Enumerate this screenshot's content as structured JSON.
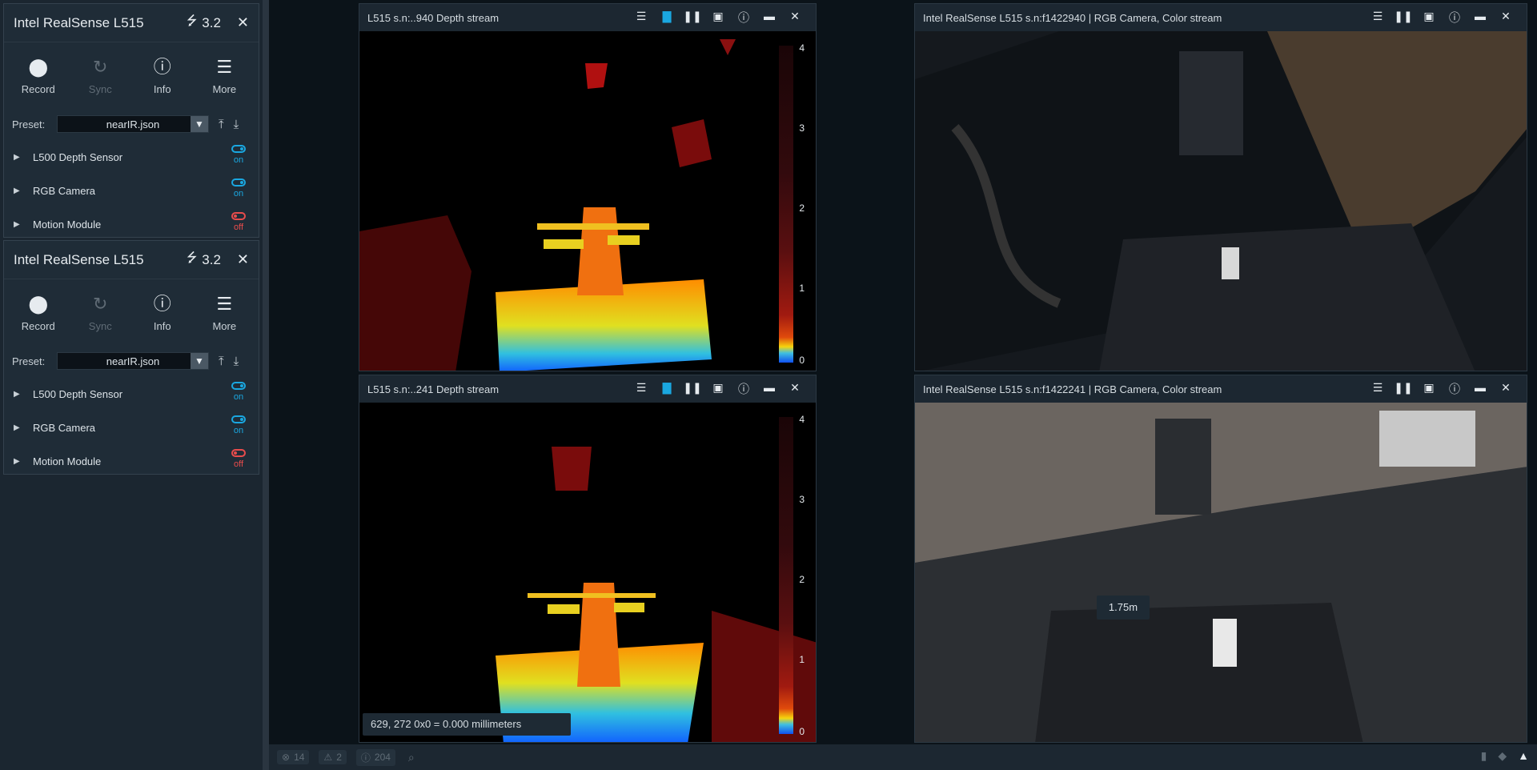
{
  "devices": [
    {
      "name": "Intel RealSense L515",
      "usb_version": "3.2",
      "tools": [
        {
          "label": "Record",
          "icon": "record-icon",
          "disabled": false
        },
        {
          "label": "Sync",
          "icon": "sync-icon",
          "disabled": true
        },
        {
          "label": "Info",
          "icon": "info-icon",
          "disabled": false
        },
        {
          "label": "More",
          "icon": "menu-icon",
          "disabled": false
        }
      ],
      "preset_label": "Preset:",
      "preset_value": "nearIR.json",
      "sensors": [
        {
          "name": "L500 Depth Sensor",
          "state": "on"
        },
        {
          "name": "RGB Camera",
          "state": "on"
        },
        {
          "name": "Motion Module",
          "state": "off"
        }
      ]
    },
    {
      "name": "Intel RealSense L515",
      "usb_version": "3.2",
      "tools": [
        {
          "label": "Record",
          "icon": "record-icon",
          "disabled": false
        },
        {
          "label": "Sync",
          "icon": "sync-icon",
          "disabled": true
        },
        {
          "label": "Info",
          "icon": "info-icon",
          "disabled": false
        },
        {
          "label": "More",
          "icon": "menu-icon",
          "disabled": false
        }
      ],
      "preset_label": "Preset:",
      "preset_value": "nearIR.json",
      "sensors": [
        {
          "name": "L500 Depth Sensor",
          "state": "on"
        },
        {
          "name": "RGB Camera",
          "state": "on"
        },
        {
          "name": "Motion Module",
          "state": "off"
        }
      ]
    }
  ],
  "streams": {
    "depth1": {
      "title": "L515 s.n:..940 Depth stream",
      "colorbar_ticks": [
        "4",
        "3",
        "2",
        "1",
        "0"
      ]
    },
    "rgb1": {
      "title": "Intel RealSense L515 s.n:f1422940 | RGB Camera, Color stream"
    },
    "depth2": {
      "title": "L515 s.n:..241 Depth stream",
      "colorbar_ticks": [
        "4",
        "3",
        "2",
        "1",
        "0"
      ],
      "pixel_info": "629, 272 0x0 = 0.000 millimeters"
    },
    "rgb2": {
      "title": "Intel RealSense L515 s.n:f1422241 | RGB Camera, Color stream"
    }
  },
  "distance_label": "1.75m",
  "statusbar": {
    "errors": "14",
    "warnings": "2",
    "info": "204"
  },
  "colors": {
    "accent": "#1aa7e0",
    "off": "#e84c4c",
    "panel": "#1f2c37"
  }
}
